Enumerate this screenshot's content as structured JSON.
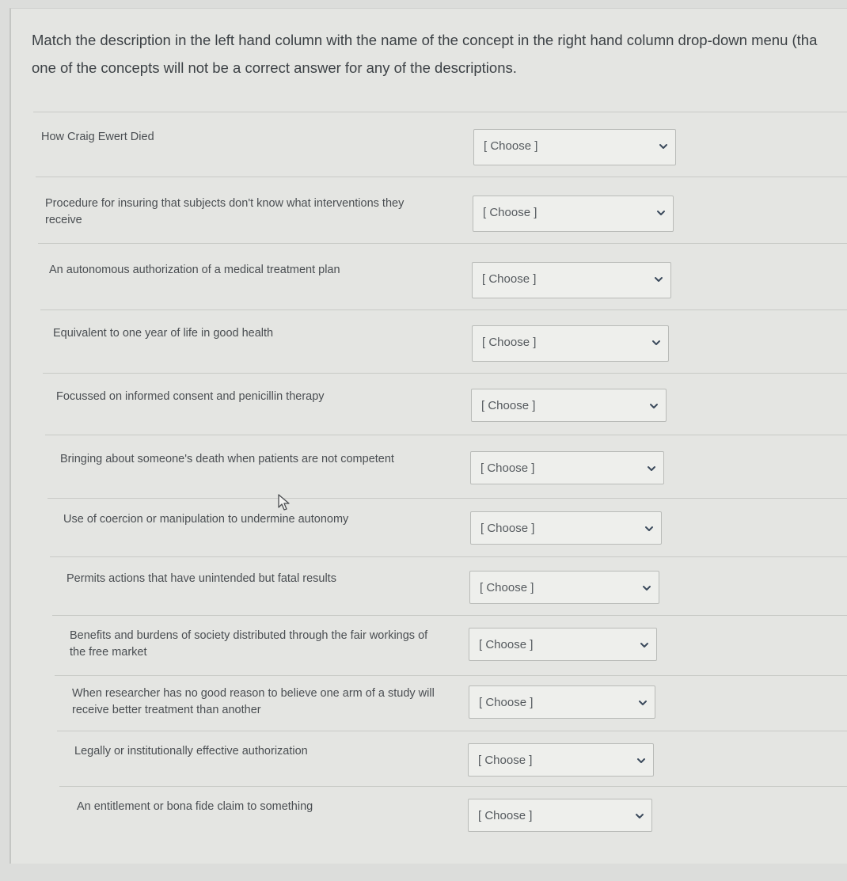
{
  "instructions": {
    "line1": "Match the description in the left hand column with the name of the concept in the right hand column drop-down menu (tha",
    "line2": "one of the concepts will not be a correct answer for any of the descriptions."
  },
  "placeholder": "[ Choose ]",
  "rows": [
    {
      "description": [
        "How Craig Ewert Died"
      ]
    },
    {
      "description": [
        "Procedure for insuring that subjects don't know what interventions they",
        "receive"
      ]
    },
    {
      "description": [
        "An autonomous authorization of a medical treatment plan"
      ]
    },
    {
      "description": [
        "Equivalent to one year of life in good health"
      ]
    },
    {
      "description": [
        "Focussed on informed consent and penicillin therapy"
      ]
    },
    {
      "description": [
        "Bringing about someone's death when patients are not competent"
      ]
    },
    {
      "description": [
        "Use of coercion or manipulation to undermine autonomy"
      ]
    },
    {
      "description": [
        "Permits actions that have unintended but fatal results"
      ]
    },
    {
      "description": [
        "Benefits and burdens of society distributed through the fair workings of",
        "the free market"
      ]
    },
    {
      "description": [
        "When researcher has no good reason to believe one arm of a study will",
        "receive better treatment than another"
      ]
    },
    {
      "description": [
        "Legally or institutionally effective authorization"
      ]
    },
    {
      "description": [
        "An entitlement or bona fide claim to something"
      ]
    }
  ],
  "icons": {
    "dropdown": "chevron-down-icon",
    "cursor": "mouse-pointer-icon"
  },
  "colors": {
    "background": "#e4e5e2",
    "text": "#3c4145",
    "chevron": "#3b4a5c"
  }
}
